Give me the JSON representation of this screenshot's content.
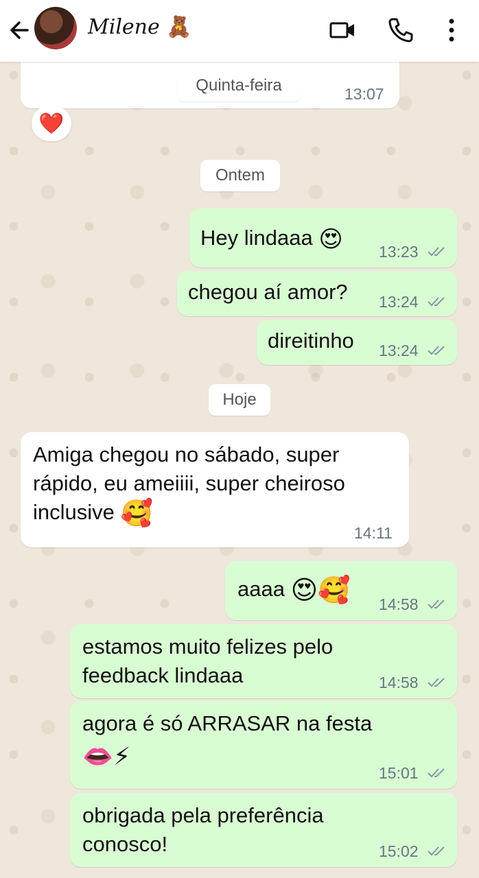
{
  "header": {
    "contact_name": "Milene",
    "contact_emoji": "🧸"
  },
  "date_labels": {
    "previous": "Quinta-feira",
    "yesterday": "Ontem",
    "today": "Hoje"
  },
  "messages": [
    {
      "direction": "in",
      "text": "",
      "time": "13:07"
    },
    {
      "direction": "out",
      "text": "Hey lindaaa",
      "emoji": "😍",
      "time": "13:23"
    },
    {
      "direction": "out",
      "text": "chegou aí amor?",
      "time": "13:24"
    },
    {
      "direction": "out",
      "text": "direitinho",
      "time": "13:24"
    },
    {
      "direction": "in",
      "text": "Amiga chegou no sábado, super rápido, eu ameiiii, super cheiroso inclusive",
      "emoji": "🥰",
      "time": "14:11"
    },
    {
      "direction": "out",
      "text": "aaaa",
      "emoji": "😍🥰",
      "time": "14:58"
    },
    {
      "direction": "out",
      "text": "estamos muito felizes pelo feedback lindaaa",
      "time": "14:58"
    },
    {
      "direction": "out",
      "text": "agora é só ARRASAR na festa",
      "emoji": "👄⚡",
      "time": "15:01"
    },
    {
      "direction": "out",
      "text": "obrigada pela preferência conosco!",
      "time": "15:02"
    }
  ],
  "reaction_emoji": "❤️",
  "colors": {
    "outgoing_bubble": "#d9fdd3",
    "incoming_bubble": "#ffffff",
    "read_ticks": "#8696a0",
    "wallpaper": "#efe7dc"
  }
}
